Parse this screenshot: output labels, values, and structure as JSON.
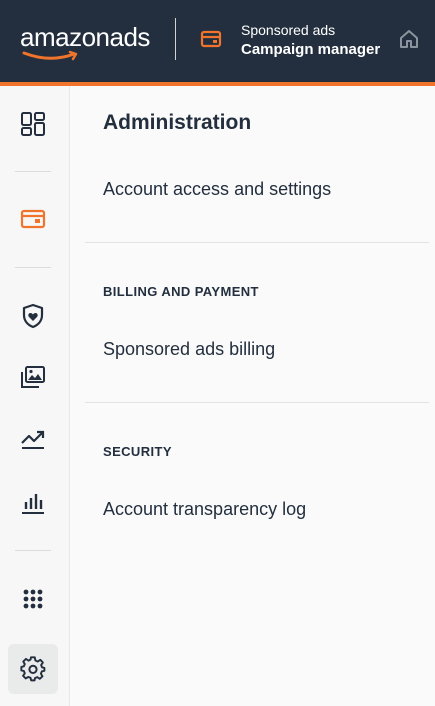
{
  "header": {
    "logo_text_regular": "amazon",
    "logo_text_bold": "ads",
    "product_subtitle": "Sponsored ads",
    "product_title": "Campaign manager",
    "product_icon": "wallet-card-icon",
    "home_icon": "home-icon"
  },
  "colors": {
    "header_bg": "#232f3e",
    "accent": "#f0742c",
    "text": "#232f3e"
  },
  "sidebar": {
    "items": [
      {
        "icon": "dashboard-grid-icon",
        "active": false
      },
      {
        "icon": "campaign-card-icon",
        "active": false,
        "accent": true
      },
      {
        "icon": "brand-shield-icon",
        "active": false
      },
      {
        "icon": "creative-gallery-icon",
        "active": false
      },
      {
        "icon": "trend-chart-icon",
        "active": false
      },
      {
        "icon": "bar-chart-icon",
        "active": false
      },
      {
        "icon": "apps-grid-icon",
        "active": false
      },
      {
        "icon": "settings-gear-icon",
        "active": true
      }
    ]
  },
  "main": {
    "title": "Administration",
    "account_link": "Account access and settings",
    "billing_section": {
      "heading": "BILLING AND PAYMENT",
      "link": "Sponsored ads billing"
    },
    "security_section": {
      "heading": "SECURITY",
      "link": "Account transparency log"
    }
  }
}
